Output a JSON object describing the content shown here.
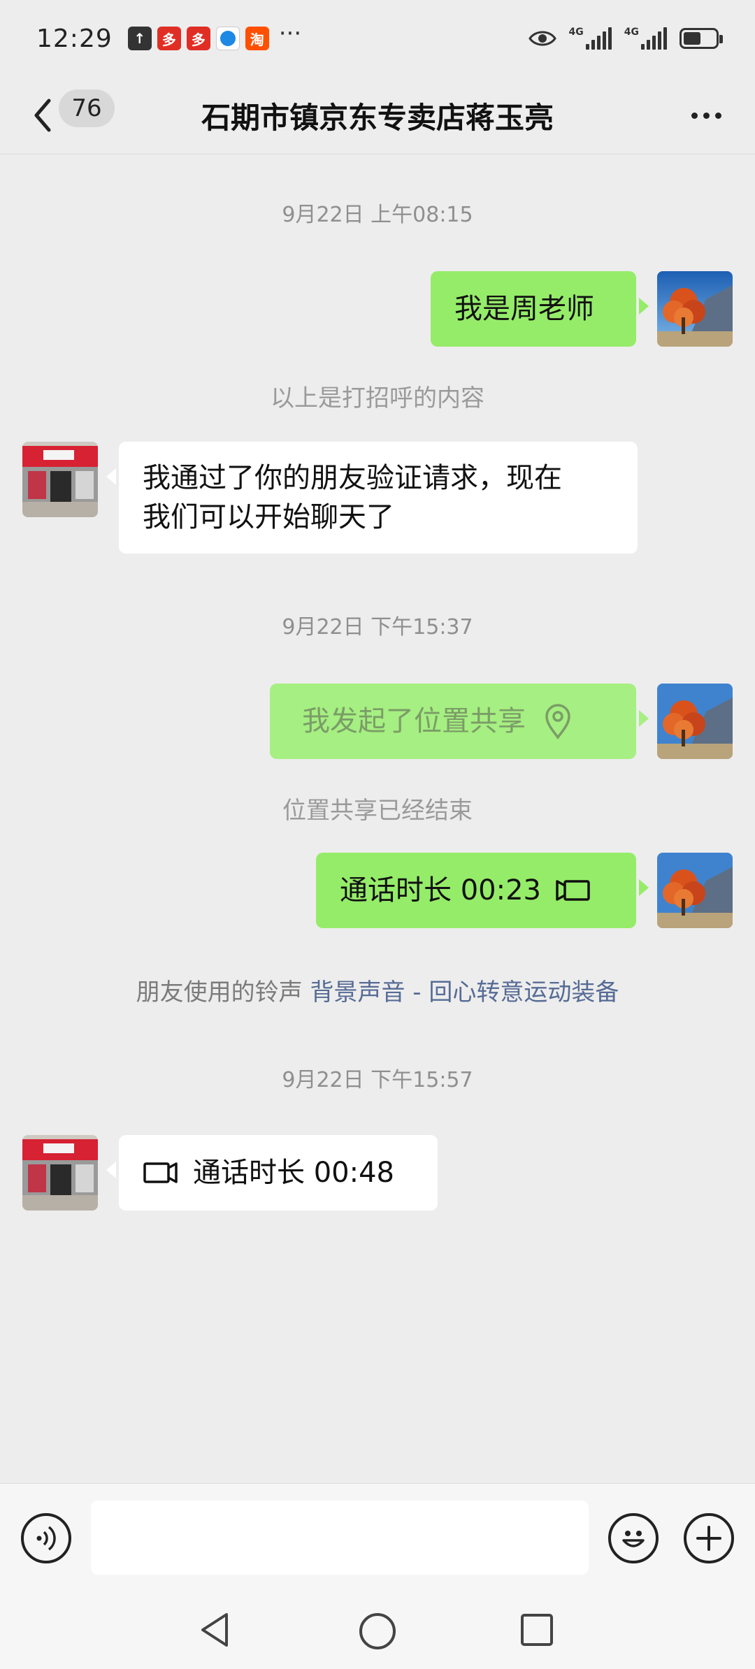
{
  "status_bar": {
    "time": "12:29",
    "network_tags": [
      "4G",
      "4G"
    ],
    "battery_level": 0.55,
    "more_label": "···"
  },
  "header": {
    "unread_count": "76",
    "title": "石期市镇京东专卖店蒋玉亮"
  },
  "messages": [
    {
      "type": "timestamp",
      "text": "9月22日 上午08:15"
    },
    {
      "type": "sent",
      "text": "我是周老师"
    },
    {
      "type": "system",
      "text": "以上是打招呼的内容"
    },
    {
      "type": "received",
      "lines": [
        "我通过了你的朋友验证请求，现在",
        "我们可以开始聊天了"
      ]
    },
    {
      "type": "timestamp",
      "text": "9月22日 下午15:37"
    },
    {
      "type": "sent_location",
      "text": "我发起了位置共享"
    },
    {
      "type": "system",
      "text": "位置共享已经结束"
    },
    {
      "type": "sent_call",
      "text": "通话时长 00:23"
    },
    {
      "type": "system_ringtone",
      "prefix": "朋友使用的铃声 ",
      "link": "背景声音 - 回心转意运动装备"
    },
    {
      "type": "timestamp",
      "text": "9月22日 下午15:57"
    },
    {
      "type": "received_call",
      "text": "通话时长 00:48"
    }
  ],
  "icons": {
    "back": "chevron-left-icon",
    "more": "more-horizontal-icon",
    "voice": "voice-input-icon",
    "emoji": "emoji-icon",
    "plus": "plus-icon",
    "location": "location-pin-icon",
    "video": "video-call-icon"
  },
  "colors": {
    "background": "#ededed",
    "sent_bubble": "#95ec69",
    "received_bubble": "#ffffff",
    "link": "#566b95"
  }
}
